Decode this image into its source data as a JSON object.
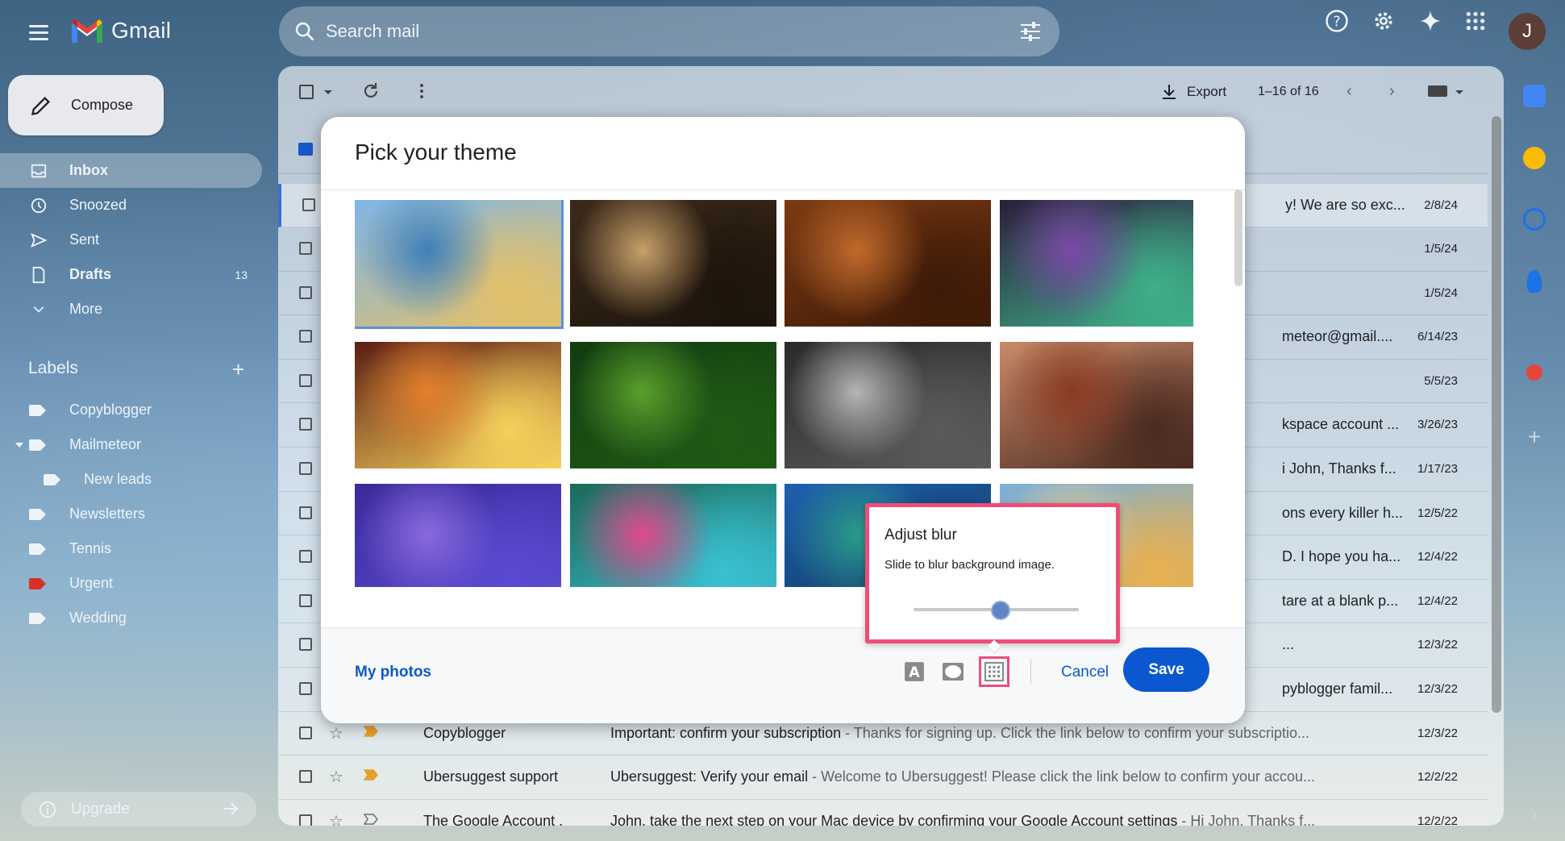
{
  "app": {
    "name": "Gmail"
  },
  "search": {
    "placeholder": "Search mail"
  },
  "user": {
    "initial": "J"
  },
  "compose": {
    "label": "Compose"
  },
  "nav": {
    "items": [
      {
        "id": "inbox",
        "label": "Inbox",
        "icon": "inbox-icon",
        "count": "",
        "active": true
      },
      {
        "id": "snoozed",
        "label": "Snoozed",
        "icon": "clock-icon",
        "count": ""
      },
      {
        "id": "sent",
        "label": "Sent",
        "icon": "send-icon",
        "count": ""
      },
      {
        "id": "drafts",
        "label": "Drafts",
        "icon": "file-icon",
        "count": "13"
      },
      {
        "id": "more",
        "label": "More",
        "icon": "chevron-down-icon",
        "count": ""
      }
    ]
  },
  "labels": {
    "title": "Labels",
    "items": [
      {
        "label": "Copyblogger",
        "color": "#eef3f8"
      },
      {
        "label": "Mailmeteor",
        "color": "#eef3f8"
      },
      {
        "label": "New leads",
        "color": "#eef3f8"
      },
      {
        "label": "Newsletters",
        "color": "#eef3f8"
      },
      {
        "label": "Tennis",
        "color": "#eef3f8"
      },
      {
        "label": "Urgent",
        "color": "#d93025"
      },
      {
        "label": "Wedding",
        "color": "#eef3f8"
      }
    ]
  },
  "upgrade": {
    "label": "Upgrade"
  },
  "toolbar": {
    "export_label": "Export",
    "pager": "1–16 of 16"
  },
  "emails": [
    {
      "sender": "",
      "subject": "",
      "snippet": "y! We are so exc...",
      "date": "2/8/24"
    },
    {
      "sender": "",
      "subject": "",
      "snippet": "",
      "date": "1/5/24"
    },
    {
      "sender": "",
      "subject": "",
      "snippet": "",
      "date": "1/5/24"
    },
    {
      "sender": "",
      "subject": "",
      "snippet": "meteor@gmail....",
      "date": "6/14/23"
    },
    {
      "sender": "",
      "subject": "",
      "snippet": "",
      "date": "5/5/23"
    },
    {
      "sender": "",
      "subject": "",
      "snippet": "kspace account ...",
      "date": "3/26/23"
    },
    {
      "sender": "",
      "subject": "",
      "snippet": "i John, Thanks f...",
      "date": "1/17/23"
    },
    {
      "sender": "",
      "subject": "",
      "snippet": "ons every killer h...",
      "date": "12/5/22"
    },
    {
      "sender": "",
      "subject": "",
      "snippet": "D. I hope you ha...",
      "date": "12/4/22"
    },
    {
      "sender": "",
      "subject": "",
      "snippet": "tare at a blank p...",
      "date": "12/4/22"
    },
    {
      "sender": "",
      "subject": "",
      "snippet": "...",
      "date": "12/3/22"
    },
    {
      "sender": "",
      "subject": "",
      "snippet": "pyblogger famil...",
      "date": "12/3/22"
    },
    {
      "sender": "Copyblogger",
      "subject": "Important: confirm your subscription",
      "snippet": " - Thanks for signing up. Click the link below to confirm your subscriptio...",
      "date": "12/3/22"
    },
    {
      "sender": "Ubersuggest support",
      "subject": "Ubersuggest: Verify your email",
      "snippet": " - Welcome to Ubersuggest! Please click the link below to confirm your accou...",
      "date": "12/2/22"
    },
    {
      "sender": "The Google Account .",
      "subject": "John, take the next step on your Mac device by confirming your Google Account settings",
      "snippet": " - Hi John, Thanks f...",
      "date": "12/2/22"
    }
  ],
  "modal": {
    "title": "Pick your theme",
    "my_photos": "My photos",
    "cancel": "Cancel",
    "save": "Save",
    "themes": [
      {
        "name": "beach-child",
        "selected": true,
        "c1": "#7fb6e6",
        "c2": "#3f7fb7",
        "c3": "#e3c06a"
      },
      {
        "name": "chess",
        "c1": "#3b2a1a",
        "c2": "#c8a06a",
        "c3": "#1d140c"
      },
      {
        "name": "autumn-leaves",
        "c1": "#7c3a12",
        "c2": "#c06a2b",
        "c3": "#3d1a08"
      },
      {
        "name": "bokeh-lights",
        "c1": "#2b1d3a",
        "c2": "#7a4aa8",
        "c3": "#3fb08a"
      },
      {
        "name": "canyon-rock",
        "c1": "#5a1c12",
        "c2": "#e5802c",
        "c3": "#f6d15c"
      },
      {
        "name": "caterpillar",
        "c1": "#123d10",
        "c2": "#5aa02c",
        "c3": "#1f5a14"
      },
      {
        "name": "metal-pipes",
        "c1": "#2a2a2a",
        "c2": "#b5b5b5",
        "c3": "#5a5a5a"
      },
      {
        "name": "horseshoe-canyon",
        "c1": "#c98a6a",
        "c2": "#8a3a20",
        "c3": "#4a2a20"
      },
      {
        "name": "jellyfish",
        "c1": "#3a2a9a",
        "c2": "#8a6ae0",
        "c3": "#5a4ad0"
      },
      {
        "name": "rainbow-bubble",
        "c1": "#1a6a5a",
        "c2": "#e04a8a",
        "c3": "#3ac0d0"
      },
      {
        "name": "lake-trees",
        "c1": "#1f5fb0",
        "c2": "#2a9a8a",
        "c3": "#0f3a5a"
      },
      {
        "name": "beach-sky",
        "c1": "#7ab0d8",
        "c2": "#d8c8a0",
        "c3": "#e8b050"
      }
    ]
  },
  "blur": {
    "title": "Adjust blur",
    "description": "Slide to blur background image.",
    "level": 0.5
  },
  "colors": {
    "accent": "#0b57d0",
    "highlight": "#ee4d79"
  }
}
